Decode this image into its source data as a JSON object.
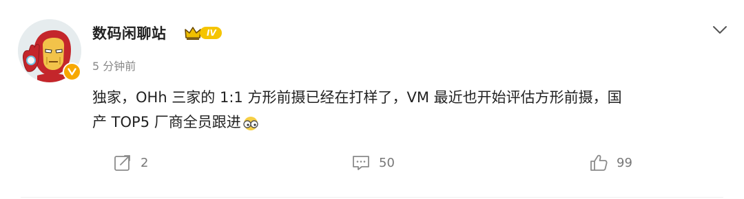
{
  "post": {
    "author": {
      "name": "数码闲聊站",
      "level_badge": "IV",
      "avatar_icon": "iron-man-avatar",
      "verified_icon": "verified-v-icon"
    },
    "timestamp": "5 分钟前",
    "content": {
      "line1": "独家，OHh 三家的 1:1 方形前摄已经在打样了，VM 最近也开始评估方形前摄，国",
      "line2": "产 TOP5 厂商全员跟进",
      "trailing_emoji": "emoji-glasses-face"
    },
    "actions": {
      "repost_count": "2",
      "comment_count": "50",
      "like_count": "99"
    },
    "colors": {
      "verified": "#f7a800",
      "level_badge": "#f5c400",
      "text": "#222222",
      "muted": "#888888"
    }
  }
}
